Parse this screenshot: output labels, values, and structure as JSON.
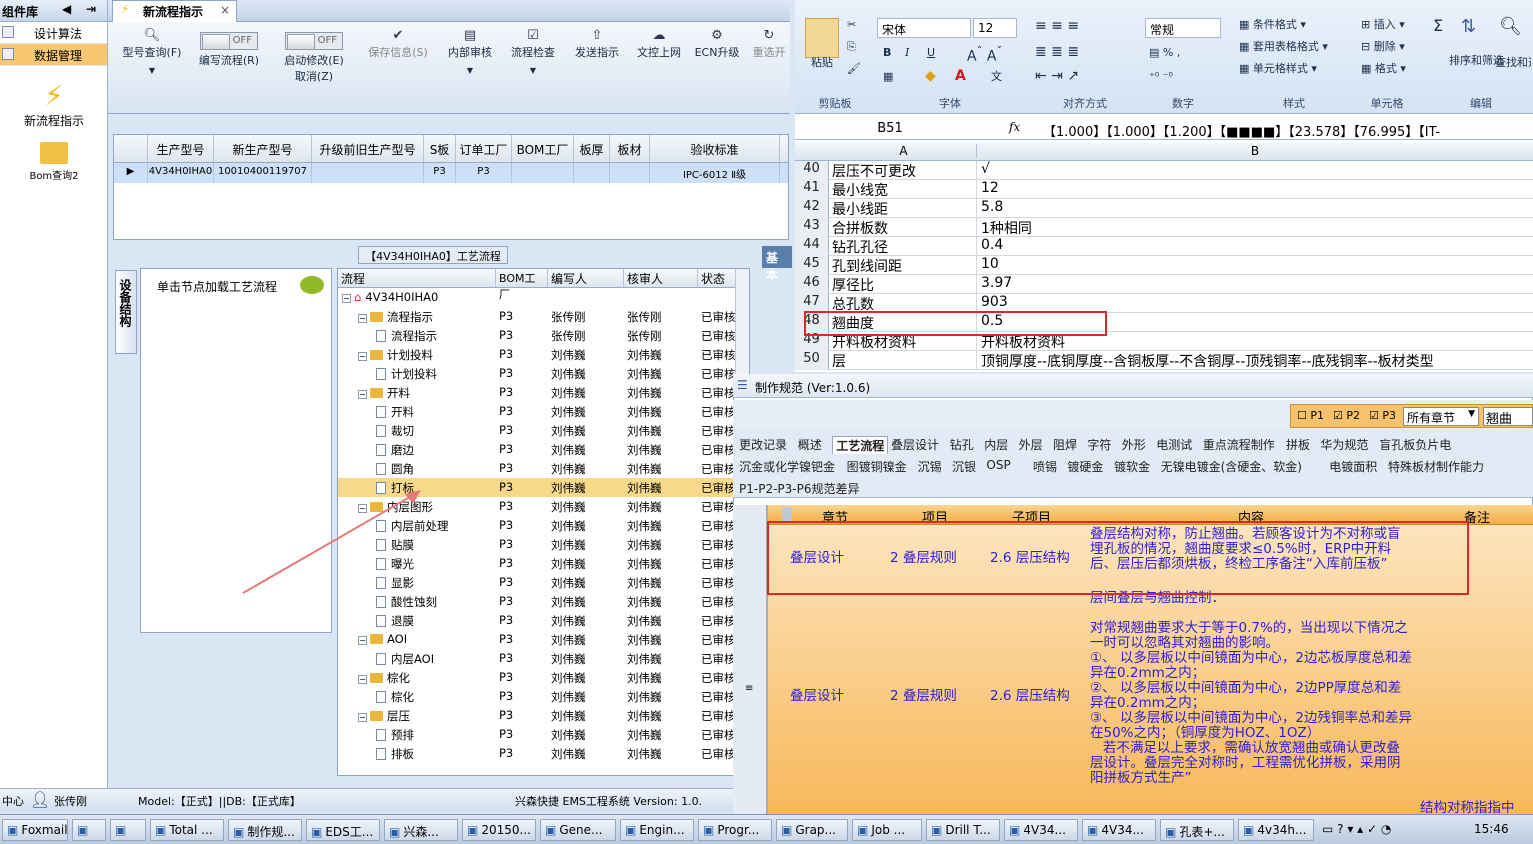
{
  "sidebar": {
    "header": "组件库",
    "items": [
      "设计算法",
      "数据管理"
    ],
    "big_items": [
      "新流程指示",
      "Bom查询2"
    ]
  },
  "app": {
    "tab_title": "新流程指示",
    "toolbar": {
      "query": "型号查询(F)",
      "edit_flow": "编写流程(R)",
      "start_mod": "启动修改(E)",
      "cancel": "取消(Z)",
      "toggle_off": "OFF",
      "save": "保存信息(S)",
      "inner_review": "内部审核",
      "flow_check": "流程检查",
      "send": "发送指示",
      "upload": "文控上网",
      "ecn": "ECN升级",
      "reopen": "重选开"
    },
    "grid": {
      "headers": [
        "生产型号",
        "新生产型号",
        "升级前旧生产型号",
        "S板",
        "订单工厂",
        "BOM工厂",
        "板厚",
        "板材",
        "验收标准"
      ],
      "row": [
        "4V34H0IHA0",
        "10010400119707",
        "",
        "P3",
        "P3",
        "",
        "",
        "",
        "IPC-6012 Ⅱ级"
      ]
    },
    "process_title": "【4V34H0IHA0】工艺流程",
    "vtab": "设备结构",
    "node_hint": "单击节点加载工艺流程",
    "tree": {
      "headers": [
        "流程",
        "BOM工厂",
        "编写人",
        "核审人",
        "状态"
      ],
      "rows": [
        {
          "name": "4V34H0IHA0",
          "lvl": 0,
          "type": "root",
          "bom": "",
          "w": "",
          "r": "",
          "s": ""
        },
        {
          "name": "流程指示",
          "lvl": 1,
          "type": "folder",
          "bom": "P3",
          "w": "张传刚",
          "r": "张传刚",
          "s": "已审核"
        },
        {
          "name": "流程指示",
          "lvl": 2,
          "type": "doc",
          "bom": "P3",
          "w": "张传刚",
          "r": "张传刚",
          "s": "已审核"
        },
        {
          "name": "计划投料",
          "lvl": 1,
          "type": "folder",
          "bom": "P3",
          "w": "刘伟巍",
          "r": "刘伟巍",
          "s": "已审核"
        },
        {
          "name": "计划投料",
          "lvl": 2,
          "type": "doc",
          "bom": "P3",
          "w": "刘伟巍",
          "r": "刘伟巍",
          "s": "已审核"
        },
        {
          "name": "开料",
          "lvl": 1,
          "type": "folder",
          "bom": "P3",
          "w": "刘伟巍",
          "r": "刘伟巍",
          "s": "已审核"
        },
        {
          "name": "开料",
          "lvl": 2,
          "type": "doc",
          "bom": "P3",
          "w": "刘伟巍",
          "r": "刘伟巍",
          "s": "已审核"
        },
        {
          "name": "裁切",
          "lvl": 2,
          "type": "doc",
          "bom": "P3",
          "w": "刘伟巍",
          "r": "刘伟巍",
          "s": "已审核"
        },
        {
          "name": "磨边",
          "lvl": 2,
          "type": "doc",
          "bom": "P3",
          "w": "刘伟巍",
          "r": "刘伟巍",
          "s": "已审核"
        },
        {
          "name": "圆角",
          "lvl": 2,
          "type": "doc",
          "bom": "P3",
          "w": "刘伟巍",
          "r": "刘伟巍",
          "s": "已审核"
        },
        {
          "name": "打标",
          "lvl": 2,
          "type": "doc",
          "bom": "P3",
          "w": "刘伟巍",
          "r": "刘伟巍",
          "s": "已审核",
          "hl": true
        },
        {
          "name": "内层图形",
          "lvl": 1,
          "type": "folder",
          "bom": "P3",
          "w": "刘伟巍",
          "r": "刘伟巍",
          "s": "已审核"
        },
        {
          "name": "内层前处理",
          "lvl": 2,
          "type": "doc",
          "bom": "P3",
          "w": "刘伟巍",
          "r": "刘伟巍",
          "s": "已审核"
        },
        {
          "name": "贴膜",
          "lvl": 2,
          "type": "doc",
          "bom": "P3",
          "w": "刘伟巍",
          "r": "刘伟巍",
          "s": "已审核"
        },
        {
          "name": "曝光",
          "lvl": 2,
          "type": "doc",
          "bom": "P3",
          "w": "刘伟巍",
          "r": "刘伟巍",
          "s": "已审核"
        },
        {
          "name": "显影",
          "lvl": 2,
          "type": "doc",
          "bom": "P3",
          "w": "刘伟巍",
          "r": "刘伟巍",
          "s": "已审核"
        },
        {
          "name": "酸性蚀刻",
          "lvl": 2,
          "type": "doc",
          "bom": "P3",
          "w": "刘伟巍",
          "r": "刘伟巍",
          "s": "已审核"
        },
        {
          "name": "退膜",
          "lvl": 2,
          "type": "doc",
          "bom": "P3",
          "w": "刘伟巍",
          "r": "刘伟巍",
          "s": "已审核"
        },
        {
          "name": "AOI",
          "lvl": 1,
          "type": "folder",
          "bom": "P3",
          "w": "刘伟巍",
          "r": "刘伟巍",
          "s": "已审核"
        },
        {
          "name": "内层AOI",
          "lvl": 2,
          "type": "doc",
          "bom": "P3",
          "w": "刘伟巍",
          "r": "刘伟巍",
          "s": "已审核"
        },
        {
          "name": "棕化",
          "lvl": 1,
          "type": "folder",
          "bom": "P3",
          "w": "刘伟巍",
          "r": "刘伟巍",
          "s": "已审核"
        },
        {
          "name": "棕化",
          "lvl": 2,
          "type": "doc",
          "bom": "P3",
          "w": "刘伟巍",
          "r": "刘伟巍",
          "s": "已审核"
        },
        {
          "name": "层压",
          "lvl": 1,
          "type": "folder",
          "bom": "P3",
          "w": "刘伟巍",
          "r": "刘伟巍",
          "s": "已审核"
        },
        {
          "name": "预排",
          "lvl": 2,
          "type": "doc",
          "bom": "P3",
          "w": "刘伟巍",
          "r": "刘伟巍",
          "s": "已审核"
        },
        {
          "name": "排板",
          "lvl": 2,
          "type": "doc",
          "bom": "P3",
          "w": "刘伟巍",
          "r": "刘伟巍",
          "s": "已审核"
        }
      ]
    },
    "basic_tab": "基本",
    "status": {
      "center": "中心",
      "user": "张传刚",
      "model": "Model:【正式】||DB:【正式库】",
      "system": "兴森快捷 EMS工程系统 Version: 1.0."
    }
  },
  "excel": {
    "font": "宋体",
    "size": "12",
    "numfmt": "常规",
    "labels": {
      "paste": "粘贴",
      "clipboard": "剪贴板",
      "font": "字体",
      "align": "对齐方式",
      "number": "数字",
      "style": "样式",
      "cells": "单元格",
      "edit": "编辑",
      "cond": "条件格式",
      "table": "套用表格格式",
      "cellstyle": "单元格样式",
      "insert": "插入",
      "delete": "删除",
      "format": "格式",
      "sortfilter": "排序和筛选",
      "findselect": "查找和选择"
    },
    "cellref": "B51",
    "formula": "【1.000】【1.000】【1.200】【■■■■】【23.578】【76.995】【IT-",
    "cols": [
      "A",
      "B"
    ],
    "rows": [
      {
        "n": "40",
        "a": "层压不可更改",
        "b": "√"
      },
      {
        "n": "41",
        "a": "最小线宽",
        "b": "12"
      },
      {
        "n": "42",
        "a": "最小线距",
        "b": "5.8"
      },
      {
        "n": "43",
        "a": "合拼板数",
        "b": "1种相同"
      },
      {
        "n": "44",
        "a": "钻孔孔径",
        "b": "0.4"
      },
      {
        "n": "45",
        "a": "孔到线间距",
        "b": "10"
      },
      {
        "n": "46",
        "a": "厚径比",
        "b": "3.97"
      },
      {
        "n": "47",
        "a": "总孔数",
        "b": "903"
      },
      {
        "n": "48",
        "a": "翘曲度",
        "b": "0.5"
      },
      {
        "n": "49",
        "a": "开料板材资料",
        "b": "开料板材资料"
      },
      {
        "n": "50",
        "a": "层",
        "b": "顶铜厚度--底铜厚度--含铜板厚--不含铜厚--顶残铜率--底残铜率--板材类型"
      }
    ]
  },
  "dialog": {
    "title": "制作规范 (Ver:1.0.6)",
    "filter": {
      "p1": "P1",
      "p2": "P2",
      "p3": "P3",
      "select": "所有章节",
      "search": "翘曲"
    },
    "chapters": [
      "更改记录",
      "概述",
      "工艺流程",
      "叠层设计",
      "钻孔",
      "内层",
      "外层",
      "阻焊",
      "字符",
      "外形",
      "电测试",
      "重点流程制作",
      "拼板",
      "华为规范",
      "盲孔板负片电",
      "沉金或化学镍钯金",
      "图镀铜镍金",
      "沉锡",
      "沉银",
      "OSP",
      "喷锡",
      "镀硬金",
      "镀软金",
      "无镍电镀金(含硬金、软金)",
      "电镀面积",
      "特殊板材制作能力",
      "P1-P2-P3-P6规范差异"
    ],
    "headers": [
      "章节",
      "项目",
      "子项目",
      "内容",
      "备注"
    ],
    "rows": [
      {
        "chapter": "叠层设计",
        "item": "2 叠层规则",
        "sub": "2.6 层压结构",
        "content": "叠层结构对称，防止翘曲。若顾客设计为不对称或盲埋孔板的情况，翘曲度要求≤0.5%时，ERP中开料后、层压后都须烘板，终检工序备注“入库前压板”"
      },
      {
        "chapter": "叠层设计",
        "item": "2 叠层规则",
        "sub": "2.6 层压结构",
        "content": "层间叠层与翘曲控制：\n\n对常规翘曲要求大于等于0.7%的，当出现以下情况之一时可以忽略其对翘曲的影响。\n①、 以多层板以中间镜面为中心，2边芯板厚度总和差异在0.2mm之内；\n②、 以多层板以中间镜面为中心，2边PP厚度总和差异在0.2mm之内；\n③、 以多层板以中间镜面为中心，2边残铜率总和差异在50%之内；（铜厚度为HOZ、1OZ）\n   若不满足以上要求，需确认放宽翘曲或确认更改叠层设计。叠层完全对称时，工程需优化拼板，采用阴阳拼板方式生产”"
      }
    ],
    "footer": "结构对称指指中"
  },
  "taskbar": {
    "items": [
      "Foxmail",
      "",
      "",
      "Total ...",
      "制作规...",
      "EDS工...",
      "兴森...",
      "20150...",
      "Gene...",
      "Engin...",
      "Progr...",
      "Grap...",
      "Job ...",
      "Drill T...",
      "4V34...",
      "4V34...",
      "孔表+...",
      "4v34h..."
    ],
    "time": "15:46"
  }
}
